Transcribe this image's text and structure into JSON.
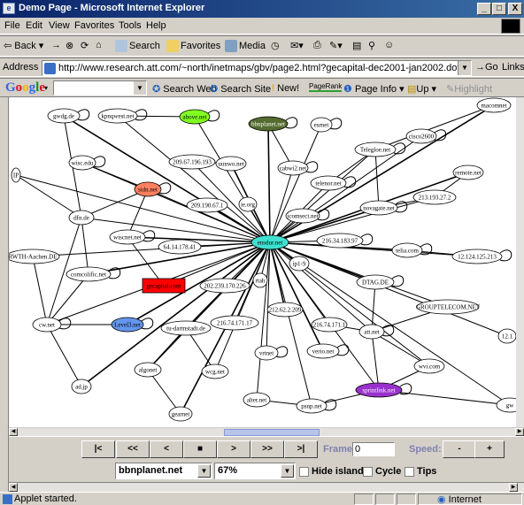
{
  "window": {
    "title": "Demo Page - Microsoft Internet Explorer",
    "controls": [
      "_",
      "□",
      "X"
    ]
  },
  "menu": [
    "File",
    "Edit",
    "View",
    "Favorites",
    "Tools",
    "Help"
  ],
  "toolbar": {
    "back": "Back",
    "forward": "→",
    "search": "Search",
    "favorites": "Favorites",
    "media": "Media"
  },
  "address": {
    "label": "Address",
    "url": "http://www.research.att.com/~north/inetmaps/gbv/page2.html?gecapital-dec2001-jan2002.dot",
    "go": "Go",
    "links": "Links"
  },
  "googlebar": {
    "logo": "Google",
    "search_web": "Search Web",
    "search_site": "Search Site",
    "new": "New!",
    "pagerank": "PageRank",
    "page_info": "Page Info",
    "up": "Up",
    "highlight": "Highlight"
  },
  "graph": {
    "nodes": [
      {
        "label": "gwdg.de",
        "color": "#ffffff"
      },
      {
        "label": "kpnqwest.net",
        "color": "#ffffff"
      },
      {
        "label": "above.net",
        "color": "#80ff20"
      },
      {
        "label": "bbnplanet.net",
        "color": "#556b2f"
      },
      {
        "label": "esrnet",
        "color": "#ffffff"
      },
      {
        "label": "cisco2600",
        "color": "#ffffff"
      },
      {
        "label": "macomnet",
        "color": "#ffffff"
      },
      {
        "label": "wisc.edu",
        "color": "#ffffff"
      },
      {
        "label": "209.67.196.193",
        "color": "#ffffff"
      },
      {
        "label": "uunwo.net",
        "color": "#ffffff"
      },
      {
        "label": "cabwi2.net",
        "color": "#ffffff"
      },
      {
        "label": "Telegloe.net",
        "color": "#ffffff"
      },
      {
        "label": "remote.net",
        "color": "#ffffff"
      },
      {
        "label": "sidn.net",
        "color": "#ff8060"
      },
      {
        "label": "telenor.net",
        "color": "#ffffff"
      },
      {
        "label": "209.190.67.1",
        "color": "#ffffff"
      },
      {
        "label": "ie.org",
        "color": "#ffffff"
      },
      {
        "label": "icomsect.net",
        "color": "#ffffff"
      },
      {
        "label": "novagate.net",
        "color": "#ffffff"
      },
      {
        "label": "213.193.27.2",
        "color": "#ffffff"
      },
      {
        "label": "dfn.de",
        "color": "#ffffff"
      },
      {
        "label": "wiscnet.net",
        "color": "#ffffff"
      },
      {
        "label": "64.14.178.41",
        "color": "#ffffff"
      },
      {
        "label": "ensdur.net",
        "color": "#40e0d0"
      },
      {
        "label": "216.34.183.97",
        "color": "#ffffff"
      },
      {
        "label": "telia.com",
        "color": "#ffffff"
      },
      {
        "label": "12.124.125.213",
        "color": "#ffffff"
      },
      {
        "label": "RWTH-Aachen.DE",
        "color": "#ffffff"
      },
      {
        "label": "comcolific.net",
        "color": "#ffffff"
      },
      {
        "label": "gecapital.com",
        "color": "#ff0000"
      },
      {
        "label": "202.239.170.226",
        "color": "#ffffff"
      },
      {
        "label": "DTAG.DE",
        "color": "#ffffff"
      },
      {
        "label": "GROUPTELECOM.NET",
        "color": "#ffffff"
      },
      {
        "label": "cw.net",
        "color": "#ffffff"
      },
      {
        "label": "Level3.net",
        "color": "#6495ed"
      },
      {
        "label": "tu-darmstadt.de",
        "color": "#ffffff"
      },
      {
        "label": "216.74.171.17",
        "color": "#ffffff"
      },
      {
        "label": "212.62.2.209",
        "color": "#ffffff"
      },
      {
        "label": "216.74.171.1",
        "color": "#ffffff"
      },
      {
        "label": "att.net",
        "color": "#ffffff"
      },
      {
        "label": "algonet",
        "color": "#ffffff"
      },
      {
        "label": "wcg.net",
        "color": "#ffffff"
      },
      {
        "label": "vrtnet",
        "color": "#ffffff"
      },
      {
        "label": "verio.net",
        "color": "#ffffff"
      },
      {
        "label": "wvi.com",
        "color": "#ffffff"
      },
      {
        "label": "sprintlink.net",
        "color": "#9932cc"
      },
      {
        "label": "ad.jp",
        "color": "#ffffff"
      },
      {
        "label": "alter.net",
        "color": "#ffffff"
      },
      {
        "label": "psnp.net",
        "color": "#ffffff"
      },
      {
        "label": "gearnet",
        "color": "#ffffff"
      },
      {
        "label": "gw",
        "color": "#ffffff"
      },
      {
        "label": "IP",
        "color": "#ffffff"
      },
      {
        "label": "ip1-9",
        "color": "#ffffff"
      },
      {
        "label": "rtah",
        "color": "#ffffff"
      },
      {
        "label": "12.1",
        "color": "#ffffff"
      }
    ]
  },
  "controls": {
    "first": "|<",
    "rewind": "<<",
    "prev": "<",
    "stop": "■",
    "next": ">",
    "ffwd": ">>",
    "last": ">|",
    "frame_label": "Frame:",
    "frame_value": "0",
    "speed_label": "Speed:",
    "speed_down": "-",
    "speed_up": "+",
    "node_select": "bbnplanet.net",
    "zoom_select": "67%",
    "hide_islands": "Hide islands",
    "cycle": "Cycle",
    "tips": "Tips"
  },
  "status": {
    "text": "Applet started.",
    "zone": "Internet"
  }
}
